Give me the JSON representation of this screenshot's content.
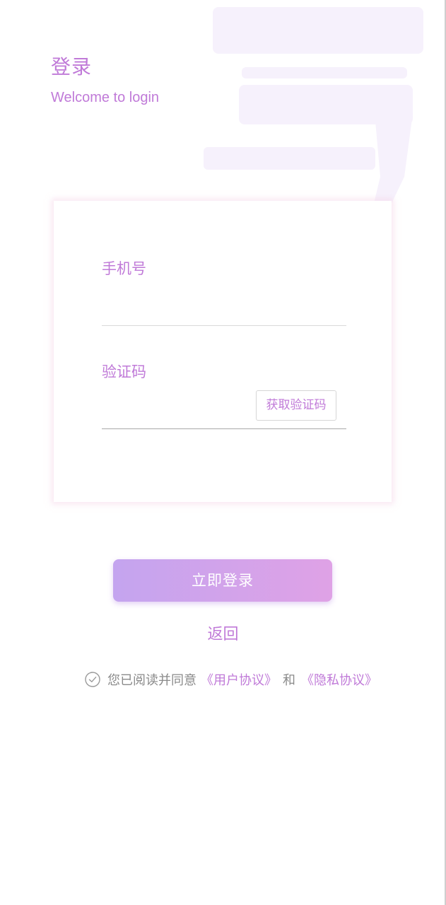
{
  "header": {
    "title": "登录",
    "subtitle": "Welcome to login"
  },
  "form": {
    "phone_label": "手机号",
    "phone_value": "",
    "code_label": "验证码",
    "code_value": "",
    "get_code_button": "获取验证码"
  },
  "actions": {
    "login_button": "立即登录",
    "back_link": "返回"
  },
  "agreement": {
    "text": "您已阅读并同意",
    "user_agreement": "《用户协议》",
    "and_text": "和",
    "privacy_policy": "《隐私协议》",
    "checkbox_icon": "check-circle-icon"
  },
  "colors": {
    "accent": "#c07ad8",
    "button_start": "#c4a4ef",
    "button_end": "#dfa2e6",
    "muted_text": "#8a8a8a"
  }
}
